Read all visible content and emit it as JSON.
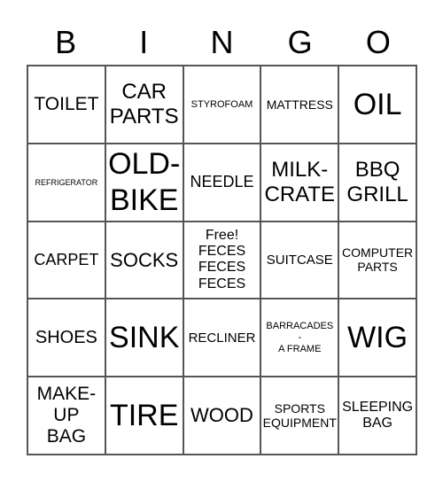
{
  "header": [
    "B",
    "I",
    "N",
    "G",
    "O"
  ],
  "cells": [
    [
      "TOILET",
      "CAR\nPARTS",
      "STYROFOAM",
      "MATTRESS",
      "OIL"
    ],
    [
      "REFRIGERATOR",
      "OLD-\nBIKE",
      "NEEDLE",
      "MILK-\nCRATE",
      "BBQ\nGRILL"
    ],
    [
      "CARPET",
      "SOCKS",
      "Free!\nFECES\nFECES\nFECES",
      "SUITCASE",
      "COMPUTER\nPARTS"
    ],
    [
      "SHOES",
      "SINK",
      "RECLINER",
      "BARRACADES\n-\nA FRAME",
      "WIG"
    ],
    [
      "MAKE-\nUP\nBAG",
      "TIRE",
      "WOOD",
      "SPORTS\nEQUIPMENT",
      "SLEEPING\nBAG"
    ]
  ]
}
